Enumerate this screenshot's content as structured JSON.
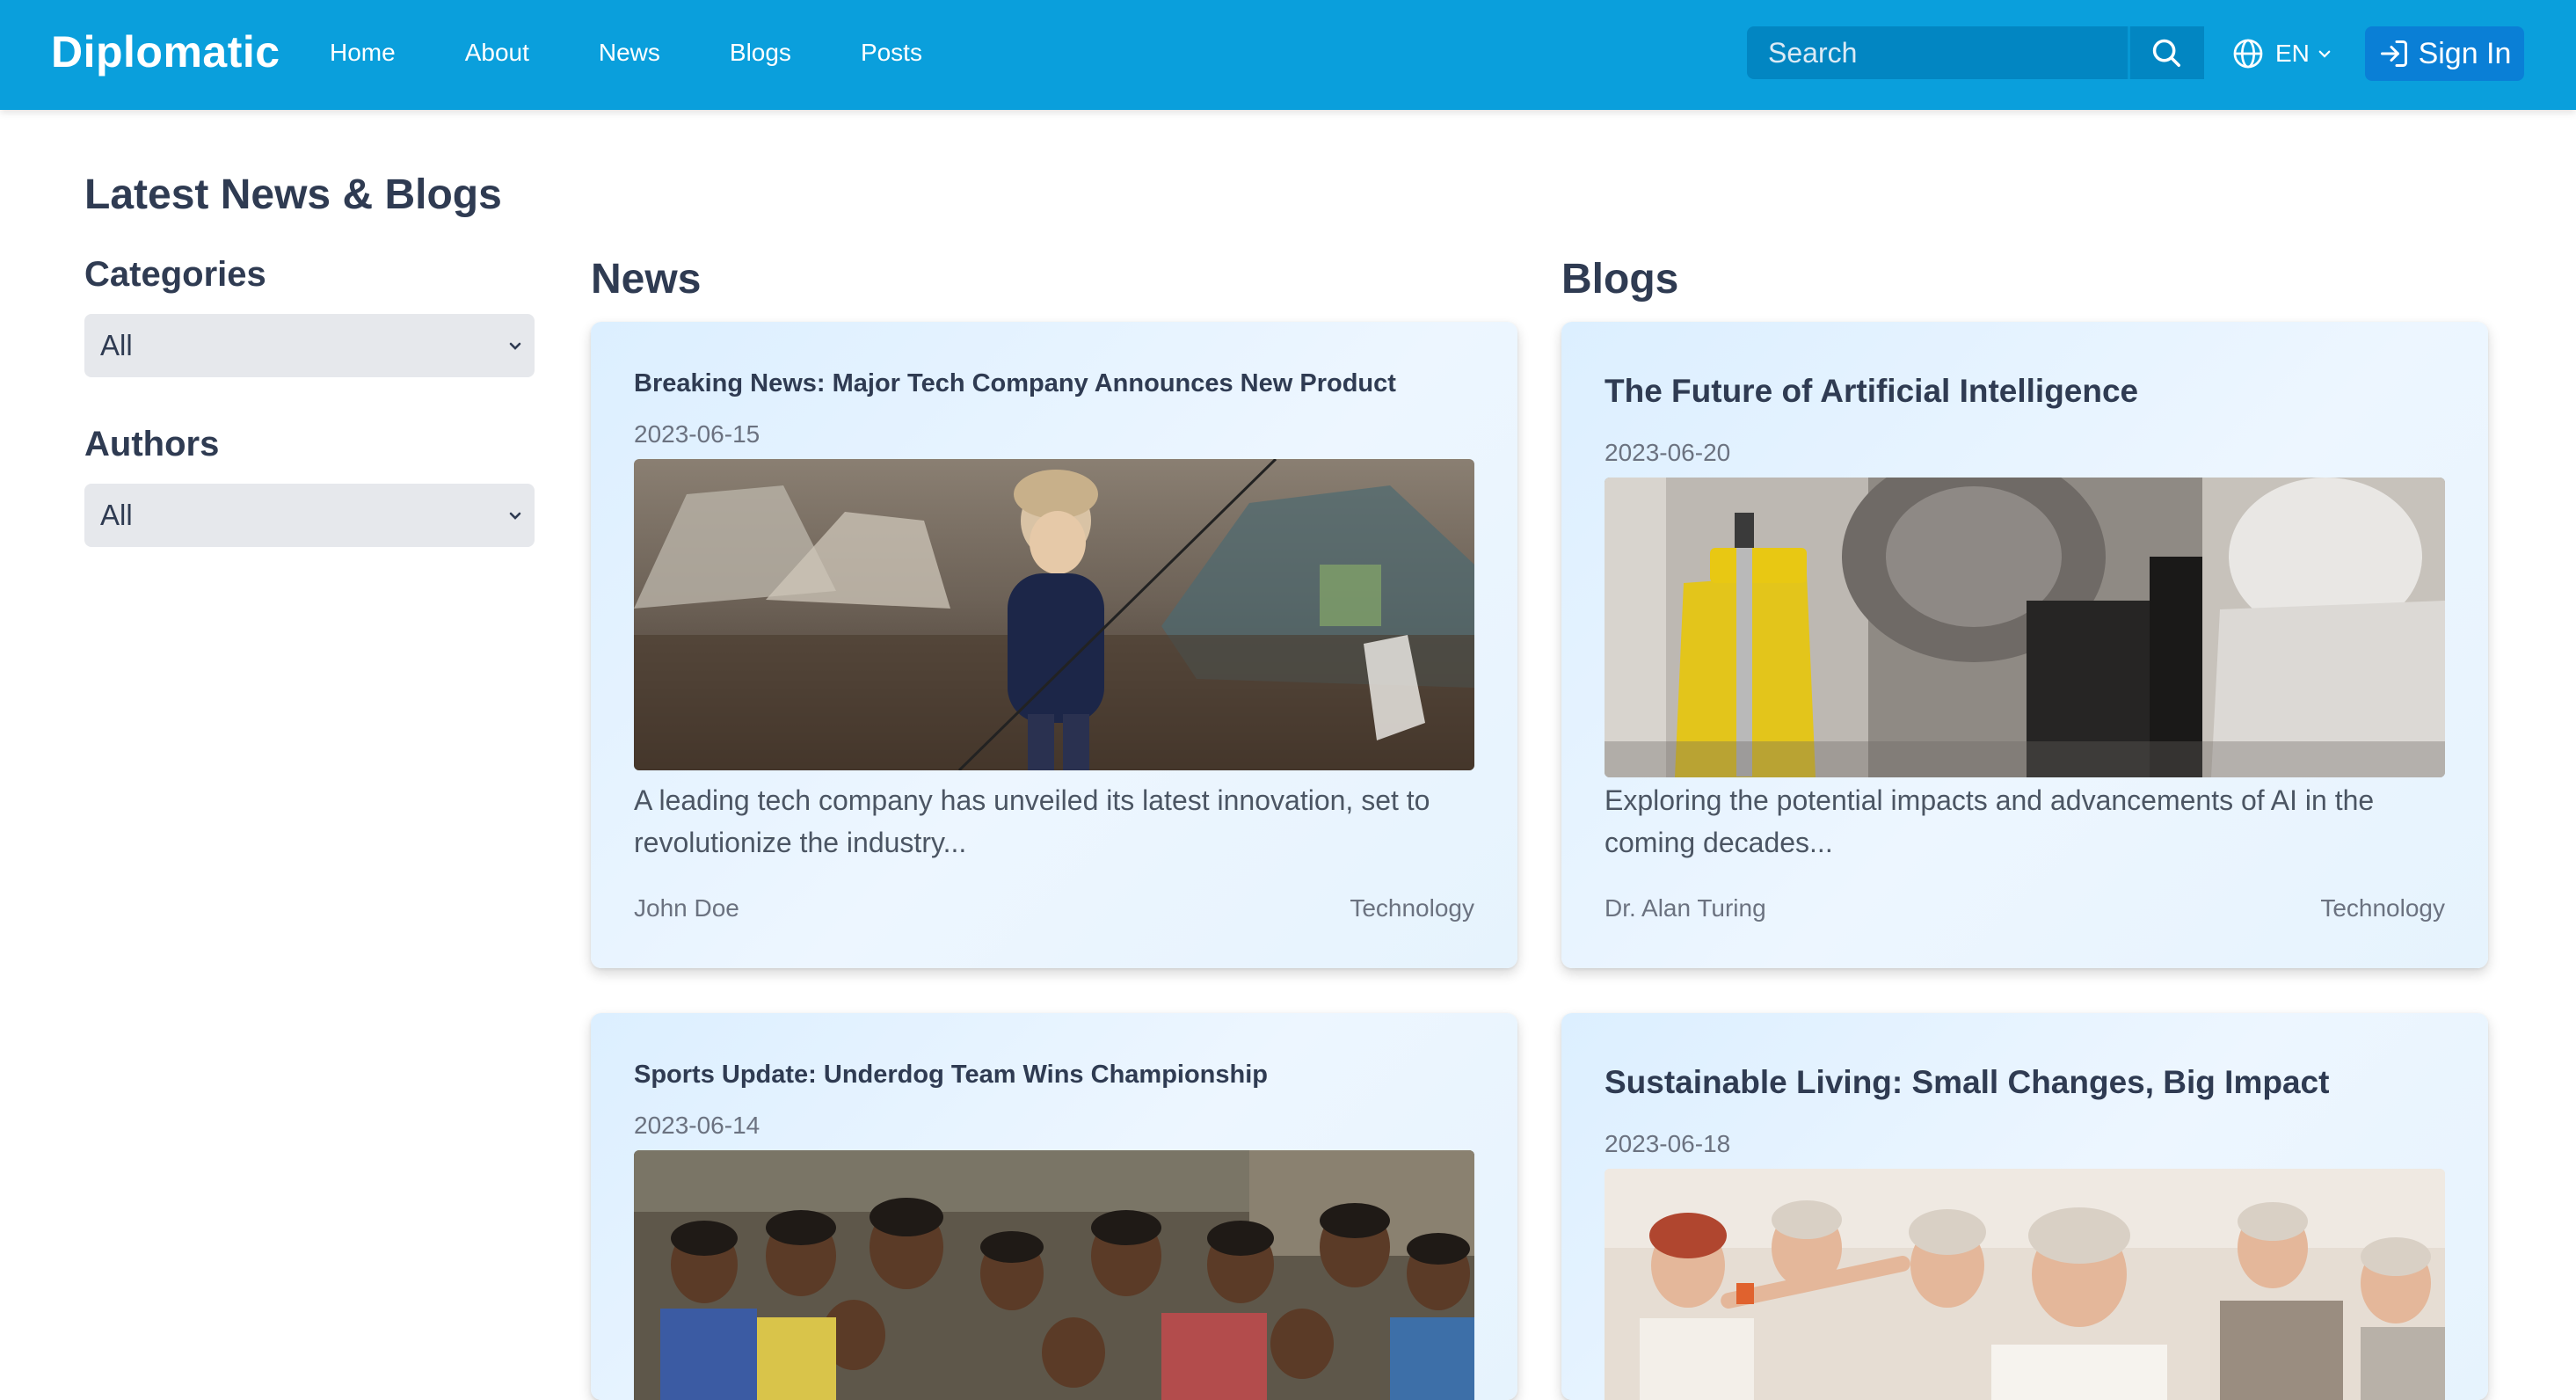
{
  "header": {
    "brand": "Diplomatic",
    "nav": [
      "Home",
      "About",
      "News",
      "Blogs",
      "Posts"
    ],
    "search_placeholder": "Search",
    "language": "EN",
    "sign_in": "Sign In",
    "bar_color": "#0a9fdc"
  },
  "page": {
    "title": "Latest News & Blogs"
  },
  "filters": {
    "categories": {
      "label": "Categories",
      "selected": "All"
    },
    "authors": {
      "label": "Authors",
      "selected": "All"
    }
  },
  "news": {
    "heading": "News",
    "items": [
      {
        "title": "Breaking News: Major Tech Company Announces New Product",
        "date": "2023-06-15",
        "excerpt": "A leading tech company has unveiled its latest innovation, set to revolutionize the industry...",
        "author": "John Doe",
        "category": "Technology"
      },
      {
        "title": "Sports Update: Underdog Team Wins Championship",
        "date": "2023-06-14"
      }
    ]
  },
  "blogs": {
    "heading": "Blogs",
    "items": [
      {
        "title": "The Future of Artificial Intelligence",
        "date": "2023-06-20",
        "excerpt": "Exploring the potential impacts and advancements of AI in the coming decades...",
        "author": "Dr. Alan Turing",
        "category": "Technology"
      },
      {
        "title": "Sustainable Living: Small Changes, Big Impact",
        "date": "2023-06-18"
      }
    ]
  }
}
